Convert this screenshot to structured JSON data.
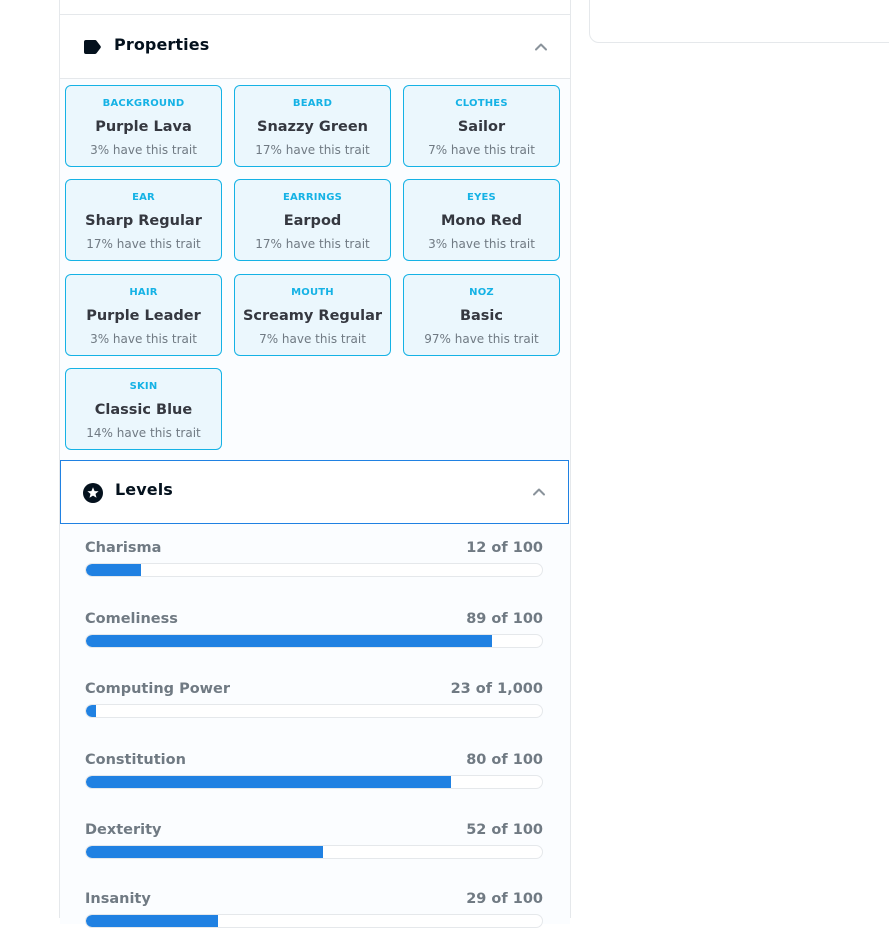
{
  "properties": {
    "title": "Properties",
    "traits": [
      {
        "type": "BACKGROUND",
        "value": "Purple Lava",
        "rarity": "3% have this trait"
      },
      {
        "type": "BEARD",
        "value": "Snazzy Green",
        "rarity": "17% have this trait"
      },
      {
        "type": "CLOTHES",
        "value": "Sailor",
        "rarity": "7% have this trait"
      },
      {
        "type": "EAR",
        "value": "Sharp Regular",
        "rarity": "17% have this trait"
      },
      {
        "type": "EARRINGS",
        "value": "Earpod",
        "rarity": "17% have this trait"
      },
      {
        "type": "EYES",
        "value": "Mono Red",
        "rarity": "3% have this trait"
      },
      {
        "type": "HAIR",
        "value": "Purple Leader",
        "rarity": "3% have this trait"
      },
      {
        "type": "MOUTH",
        "value": "Screamy Regular",
        "rarity": "7% have this trait"
      },
      {
        "type": "NOZ",
        "value": "Basic",
        "rarity": "97% have this trait"
      },
      {
        "type": "SKIN",
        "value": "Classic Blue",
        "rarity": "14% have this trait"
      }
    ]
  },
  "levels": {
    "title": "Levels",
    "items": [
      {
        "name": "Charisma",
        "value": "12 of 100",
        "level": 12,
        "max": 100
      },
      {
        "name": "Comeliness",
        "value": "89 of 100",
        "level": 89,
        "max": 100
      },
      {
        "name": "Computing Power",
        "value": "23 of 1,000",
        "level": 23,
        "max": 1000
      },
      {
        "name": "Constitution",
        "value": "80 of 100",
        "level": 80,
        "max": 100
      },
      {
        "name": "Dexterity",
        "value": "52 of 100",
        "level": 52,
        "max": 100
      },
      {
        "name": "Insanity",
        "value": "29 of 100",
        "level": 29,
        "max": 100
      }
    ]
  },
  "colors": {
    "accent": "#2081e2",
    "trait_border": "#15b2e5",
    "trait_bg": "#ebf7fd"
  },
  "icons": {
    "properties": "tag-icon",
    "levels": "star-badge-icon",
    "collapse": "chevron-up-icon"
  }
}
